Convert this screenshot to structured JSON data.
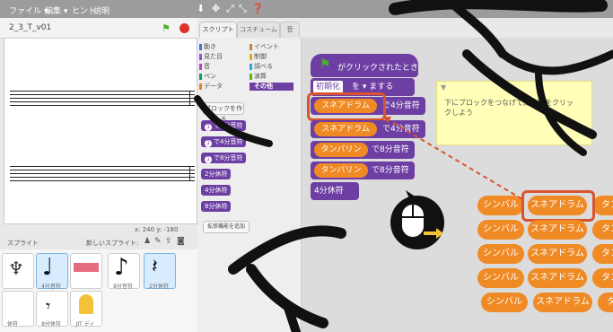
{
  "menu": {
    "items": [
      "ファイル ▾",
      "編集 ▾",
      "ヒント",
      "説明"
    ]
  },
  "project": {
    "title": "2_3_T_v01"
  },
  "stage": {
    "coords": "x: 240  y: -180"
  },
  "tabs": [
    "スクリプト",
    "コスチューム",
    "音"
  ],
  "categories": {
    "left": [
      "動き",
      "見た目",
      "音",
      "ペン",
      "データ"
    ],
    "right": [
      "イベント",
      "制御",
      "調べる",
      "演算",
      "その他"
    ]
  },
  "palette": {
    "make_block": "ブロックを作る",
    "blocks": [
      "で2分音符",
      "で4分音符",
      "で8分音符",
      "2分休符",
      "4分休符",
      "8分休符"
    ],
    "extension": "拡張機能を追加"
  },
  "sprites": {
    "header": "スプライト",
    "new_sprite": "新しいスプライト:",
    "items": [
      {
        "label": ""
      },
      {
        "label": "4分音符"
      },
      {
        "label": ""
      },
      {
        "label": "8分音符"
      },
      {
        "label": "2分休符"
      },
      {
        "label": "休符"
      },
      {
        "label": "8分休符"
      },
      {
        "label": "JIT ディ"
      }
    ]
  },
  "script": {
    "hat": "がクリックされたとき",
    "init": "初期化",
    "init_suffix": "を ▾ まする",
    "rows": [
      {
        "sound": "スネアドラム",
        "suffix": "で4分音符"
      },
      {
        "sound": "スネアドラム",
        "suffix": "で4分音符"
      },
      {
        "sound": "タンバリン",
        "suffix": "で8分音符"
      },
      {
        "sound": "タンバリン",
        "suffix": "で8分音符"
      }
    ],
    "rest": "4分休符"
  },
  "note": {
    "text": "下にブロックをつなげて緑の旗をクリックしよう"
  },
  "choices": {
    "rows": [
      [
        "シンバル",
        "スネアドラム",
        "タン"
      ],
      [
        "シンバル",
        "スネアドラム",
        "タン"
      ],
      [
        "シンバル",
        "スネアドラム",
        "タン"
      ],
      [
        "シンバル",
        "スネアドラム",
        "タン"
      ],
      [
        "シンバル",
        "スネアドラム",
        "タン"
      ]
    ]
  },
  "colors": {
    "purple_block": "#6d3fa3",
    "orange_block": "#f08a24",
    "highlight": "#d8542c",
    "note_bg": "#ffffb8",
    "flag": "#4caf2a",
    "stop": "#e0302a"
  }
}
